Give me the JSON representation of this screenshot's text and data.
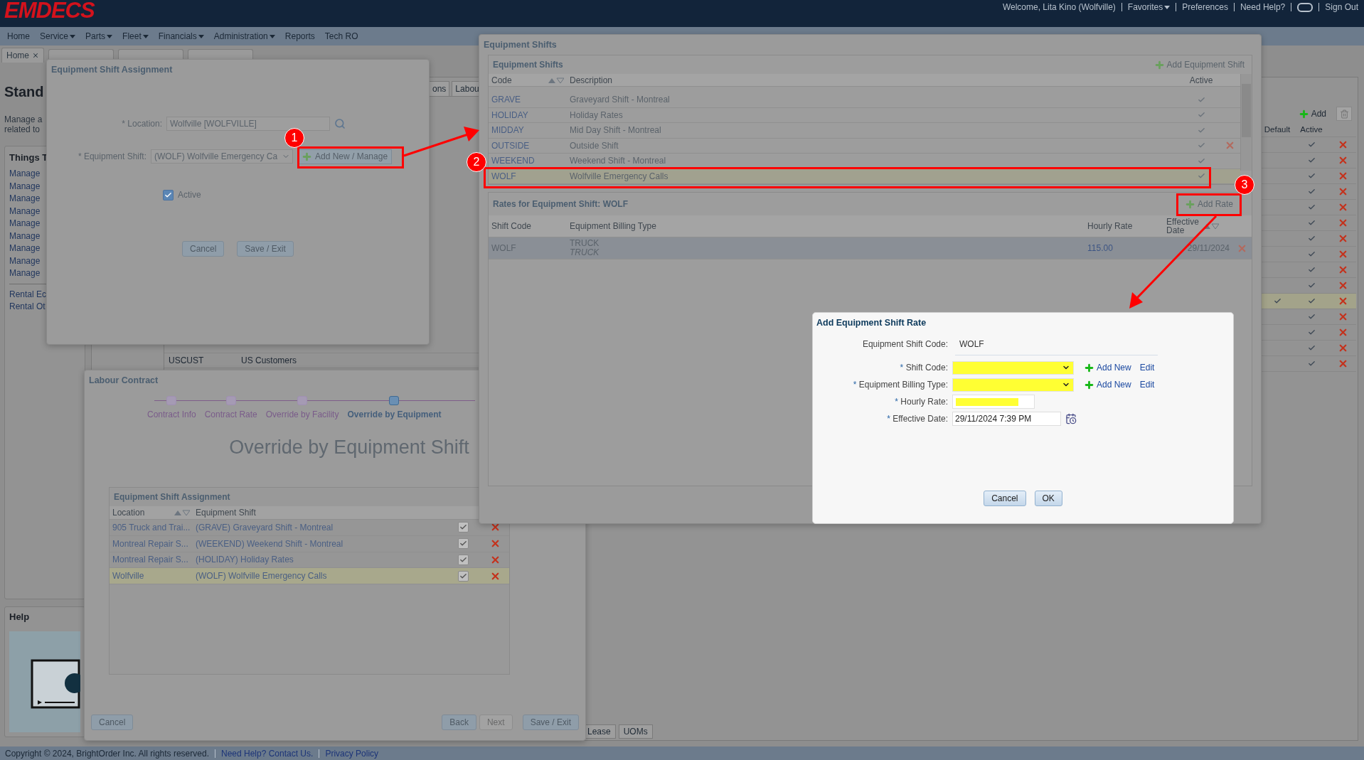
{
  "header": {
    "logo": "EMDECS",
    "welcome": "Welcome, Lita Kino (Wolfville)",
    "links": [
      {
        "label": "Favorites",
        "dropdown": true
      },
      {
        "label": "Preferences",
        "dropdown": false
      },
      {
        "label": "Need Help?",
        "dropdown": false
      }
    ],
    "sign_out": "Sign Out"
  },
  "nav": [
    {
      "label": "Home",
      "dropdown": false
    },
    {
      "label": "Service",
      "dropdown": true
    },
    {
      "label": "Parts",
      "dropdown": true
    },
    {
      "label": "Fleet",
      "dropdown": true
    },
    {
      "label": "Financials",
      "dropdown": true
    },
    {
      "label": "Administration",
      "dropdown": true
    },
    {
      "label": "Reports",
      "dropdown": false
    },
    {
      "label": "Tech RO",
      "dropdown": false
    }
  ],
  "page_tabs": [
    {
      "label": "Home",
      "closable": true
    }
  ],
  "background": {
    "title": "Stand",
    "description": [
      "Manage a",
      "related to"
    ],
    "things": {
      "title": "Things T",
      "items": [
        "Manage",
        "Manage",
        "Manage",
        "Manage",
        "Manage",
        "Manage",
        "Manage",
        "Manage",
        "Manage"
      ],
      "rental": [
        "Rental Ec",
        "Rental Ot"
      ]
    },
    "help": {
      "title": "Help"
    },
    "inner_tabs": [
      "ons",
      "Labou"
    ],
    "list_row": {
      "code": "USCUST",
      "description": "US Customers"
    },
    "right_table": {
      "add": "Add",
      "columns": [
        "Default",
        "Active"
      ],
      "rows": [
        {
          "default": false,
          "active": true,
          "highlighted": false
        },
        {
          "default": false,
          "active": true,
          "highlighted": false
        },
        {
          "default": false,
          "active": true,
          "highlighted": false
        },
        {
          "default": false,
          "active": true,
          "highlighted": false
        },
        {
          "default": false,
          "active": true,
          "highlighted": false
        },
        {
          "default": false,
          "active": true,
          "highlighted": false
        },
        {
          "default": false,
          "active": true,
          "highlighted": false
        },
        {
          "default": false,
          "active": true,
          "highlighted": false
        },
        {
          "default": false,
          "active": true,
          "highlighted": false
        },
        {
          "default": false,
          "active": true,
          "highlighted": false
        },
        {
          "default": true,
          "active": true,
          "highlighted": true
        },
        {
          "default": false,
          "active": true,
          "highlighted": false
        },
        {
          "default": false,
          "active": true,
          "highlighted": false
        },
        {
          "default": false,
          "active": true,
          "highlighted": false
        },
        {
          "default": false,
          "active": true,
          "highlighted": false
        }
      ]
    },
    "bottom_tabs": [
      "Lease",
      "UOMs"
    ]
  },
  "shift_assignment_dialog": {
    "title": "Equipment Shift Assignment",
    "required_mark": "*",
    "location_label": "Location:",
    "location_value": "Wolfville [WOLFVILLE]",
    "shift_label": "Equipment Shift:",
    "shift_value": "(WOLF) Wolfville Emergency Ca",
    "manage_button": "Add New / Manage",
    "active": {
      "label": "Active",
      "checked": true
    },
    "buttons": [
      "Cancel",
      "Save / Exit"
    ]
  },
  "shifts_dialog": {
    "title": "Equipment Shifts",
    "list": {
      "title": "Equipment Shifts",
      "add_button": "Add Equipment Shift",
      "columns": [
        "Code",
        "Description",
        "Active"
      ],
      "rows": [
        {
          "code": "GRAVE",
          "description": "Graveyard Shift - Montreal",
          "active": true,
          "deletable": false,
          "selected": false
        },
        {
          "code": "HOLIDAY",
          "description": "Holiday Rates",
          "active": true,
          "deletable": false,
          "selected": false
        },
        {
          "code": "MIDDAY",
          "description": "Mid Day Shift - Montreal",
          "active": true,
          "deletable": false,
          "selected": false
        },
        {
          "code": "OUTSIDE",
          "description": "Outside Shift",
          "active": true,
          "deletable": true,
          "selected": false
        },
        {
          "code": "WEEKEND",
          "description": "Weekend Shift - Montreal",
          "active": true,
          "deletable": false,
          "selected": false
        },
        {
          "code": "WOLF",
          "description": "Wolfville Emergency Calls",
          "active": true,
          "deletable": false,
          "selected": true
        }
      ]
    },
    "rates": {
      "title": "Rates for Equipment Shift: WOLF",
      "add_button": "Add Rate",
      "columns": [
        "Shift Code",
        "Equipment Billing Type",
        "Hourly Rate",
        "Effective Date"
      ],
      "rows": [
        {
          "shift_code": "WOLF",
          "billing_type": "TRUCK",
          "billing_type_sub": "TRUCK",
          "hourly_rate": "115.00",
          "effective_date": "29/11/2024"
        }
      ]
    }
  },
  "labour_contract_dialog": {
    "title": "Labour Contract",
    "steps": [
      {
        "label": "Contract Info",
        "current": false
      },
      {
        "label": "Contract Rate",
        "current": false
      },
      {
        "label": "Override by Facility",
        "current": false
      },
      {
        "label": "Override by Equipment",
        "current": true
      }
    ],
    "heading": "Override by Equipment Shift",
    "panel_title": "Equipment Shift Assignment",
    "columns": [
      "Location",
      "Equipment Shift"
    ],
    "rows": [
      {
        "location": "905 Truck and Trai...",
        "shift": "(GRAVE) Graveyard Shift - Montreal",
        "checked": true,
        "selected": false
      },
      {
        "location": "Montreal Repair S...",
        "shift": "(WEEKEND) Weekend Shift - Montreal",
        "checked": true,
        "selected": false
      },
      {
        "location": "Montreal Repair S...",
        "shift": "(HOLIDAY) Holiday Rates",
        "checked": true,
        "selected": false
      },
      {
        "location": "Wolfville",
        "shift": "(WOLF) Wolfville Emergency Calls",
        "checked": true,
        "selected": true
      }
    ],
    "cancel": "Cancel",
    "buttons": [
      {
        "label": "Back",
        "disabled": false
      },
      {
        "label": "Next",
        "disabled": true
      },
      {
        "label": "Save / Exit",
        "disabled": false
      }
    ]
  },
  "rate_dialog": {
    "title": "Add Equipment Shift Rate",
    "required_mark": "*",
    "code_label": "Equipment Shift Code:",
    "code_value": "WOLF",
    "fields": [
      {
        "label": "Shift Code:",
        "kind": "select",
        "add": "Add New",
        "edit": "Edit"
      },
      {
        "label": "Equipment Billing Type:",
        "kind": "select",
        "add": "Add New",
        "edit": "Edit"
      },
      {
        "label": "Hourly Rate:",
        "kind": "input"
      },
      {
        "label": "Effective Date:",
        "kind": "date",
        "value": "29/11/2024 7:39 PM"
      }
    ],
    "buttons": [
      "Cancel",
      "OK"
    ]
  },
  "annotations": [
    "1",
    "2",
    "3"
  ],
  "footer": {
    "copyright": "Copyright © 2024, BrightOrder Inc. All rights reserved.",
    "links": [
      "Need Help? Contact Us.",
      "Privacy Policy"
    ]
  }
}
